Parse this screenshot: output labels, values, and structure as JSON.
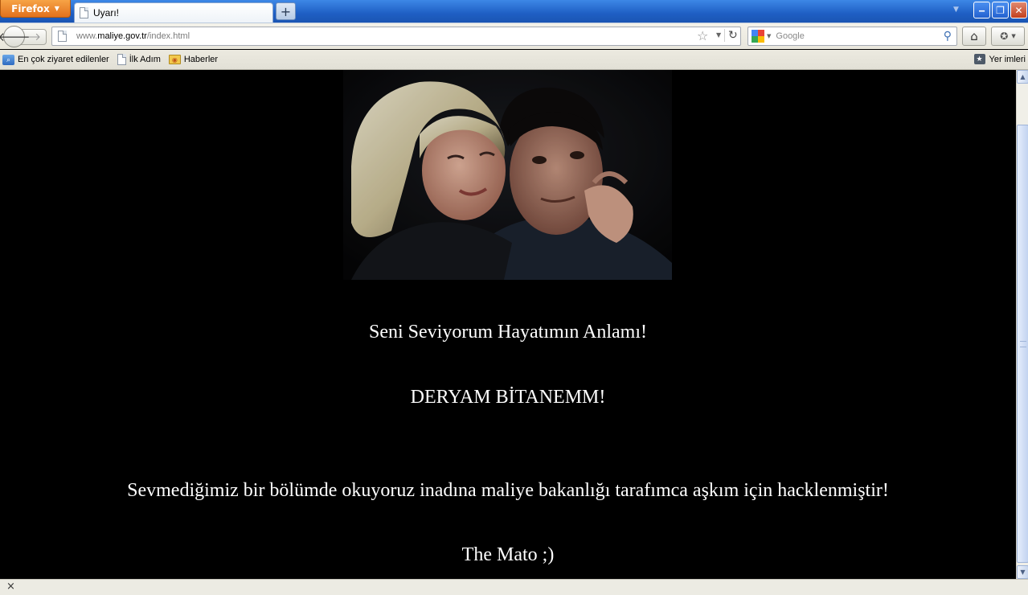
{
  "browser": {
    "menu_button_label": "Firefox",
    "tab_title": "Uyarı!",
    "new_tab_symbol": "+",
    "window_controls": {
      "minimize": "‒",
      "restore": "❐",
      "close": "✕"
    }
  },
  "navigation": {
    "url_prefix": "www.",
    "url_host": "maliye.gov.tr",
    "url_path": "/index.html",
    "search_placeholder": "Google",
    "icons": [
      "back-arrow-icon",
      "forward-arrow-icon",
      "page-icon",
      "bookmark-star-icon",
      "reload-icon",
      "google-icon",
      "magnifier-icon",
      "home-icon",
      "addon-icon"
    ]
  },
  "bookmarks": {
    "items": [
      {
        "label": "En çok ziyaret edilenler",
        "icon": "most-visited-icon"
      },
      {
        "label": "İlk Adım",
        "icon": "page-icon"
      },
      {
        "label": "Haberler",
        "icon": "rss-icon"
      }
    ],
    "right_label": "Yer imleri"
  },
  "page": {
    "background": "#000000",
    "text_color": "#ffffff",
    "line1": "Seni Seviyorum Hayatımın Anlamı!",
    "line2": "DERYAM BİTANEMM!",
    "line3": "Sevmediğimiz bir bölümde okuyoruz inadına maliye bakanlığı tarafımca aşkım için hacklenmiştir!",
    "line4": "The Mato ;)"
  },
  "statusbar": {
    "close_symbol": "×"
  },
  "colors": {
    "firefox_orange": "#e2711d",
    "titlebar_blue": "#1f5fc4"
  }
}
